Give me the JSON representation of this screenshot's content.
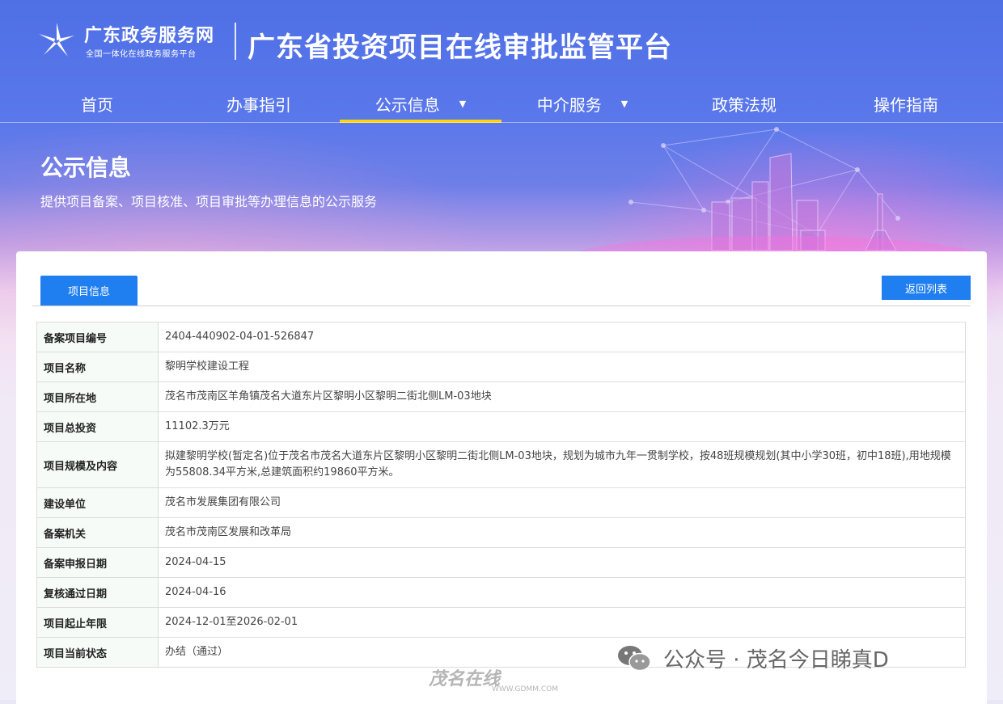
{
  "header": {
    "site_name": "广东政务服务网",
    "site_subtitle": "全国一体化在线政务服务平台",
    "platform_title": "广东省投资项目在线审批监管平台"
  },
  "nav": [
    {
      "label": "首页"
    },
    {
      "label": "办事指引"
    },
    {
      "label": "公示信息",
      "active": true
    },
    {
      "label": "中介服务"
    },
    {
      "label": "政策法规"
    },
    {
      "label": "操作指南"
    }
  ],
  "section": {
    "title": "公示信息",
    "description": "提供项目备案、项目核准、项目审批等办理信息的公示服务"
  },
  "card": {
    "tab_label": "项目信息",
    "back_button": "返回列表"
  },
  "project_info": [
    {
      "label": "备案项目编号",
      "value": "2404-440902-04-01-526847"
    },
    {
      "label": "项目名称",
      "value": "黎明学校建设工程"
    },
    {
      "label": "项目所在地",
      "value": "茂名市茂南区羊角镇茂名大道东片区黎明小区黎明二街北侧LM-03地块"
    },
    {
      "label": "项目总投资",
      "value": "11102.3万元"
    },
    {
      "label": "项目规模及内容",
      "value": "拟建黎明学校(暂定名)位于茂名市茂名大道东片区黎明小区黎明二街北侧LM-03地块，规划为城市九年一贯制学校，按48班规模规划(其中小学30班，初中18班),用地规模为55808.34平方米,总建筑面积约19860平方米。"
    },
    {
      "label": "建设单位",
      "value": "茂名市发展集团有限公司"
    },
    {
      "label": "备案机关",
      "value": "茂名市茂南区发展和改革局"
    },
    {
      "label": "备案申报日期",
      "value": "2024-04-15"
    },
    {
      "label": "复核通过日期",
      "value": "2024-04-16"
    },
    {
      "label": "项目起止年限",
      "value": "2024-12-01至2026-02-01"
    },
    {
      "label": "项目当前状态",
      "value": "办结（通过）"
    }
  ],
  "watermark": {
    "text": "公众号 · 茂名今日睇真D",
    "site_text": "茂名在线",
    "site_url": "WWW.GDMM.COM"
  },
  "icons": {
    "logo": "guangdong-gov-logo-icon",
    "wechat": "wechat-icon",
    "caret": "caret-down-icon"
  }
}
